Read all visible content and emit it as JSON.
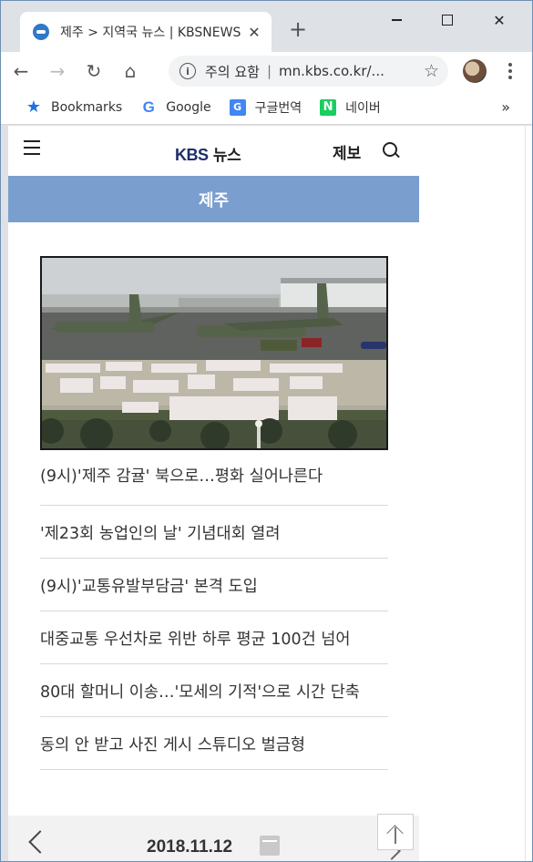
{
  "browser": {
    "tab_title": "제주 > 지역국 뉴스 | KBSNEWS",
    "tab_close": "✕",
    "new_tab": "+",
    "window_controls": {
      "minimize": "",
      "maximize": "",
      "close": "✕"
    },
    "nav": {
      "back": "←",
      "forward": "→",
      "reload": "↻",
      "home": "⌂"
    },
    "omnibox": {
      "security_label": "주의 요함",
      "separator": "|",
      "url": "mn.kbs.co.kr/...",
      "info_icon": "i",
      "star": "☆"
    },
    "bookmarks": [
      {
        "label": "Bookmarks",
        "icon": "★",
        "icon_name": "bookmarks-star-icon"
      },
      {
        "label": "Google",
        "icon": "G",
        "icon_name": "google-icon"
      },
      {
        "label": "구글번역",
        "icon": "G",
        "icon_name": "google-translate-icon"
      },
      {
        "label": "네이버",
        "icon": "N",
        "icon_name": "naver-icon"
      }
    ],
    "bookmarks_more": "»"
  },
  "site": {
    "logo_kbs": "KBS",
    "logo_news": " 뉴스",
    "report_label": "제보",
    "region": "제주",
    "headlines": [
      "(9시)'제주 감귤' 북으로…평화 실어나른다",
      "'제23회 농업인의 날' 기념대회 열려",
      "(9시)'교통유발부담금' 본격 도입",
      "대중교통 우선차로 위반 하루 평균 100건 넘어",
      "80대 할머니 이송…'모세의 기적'으로 시간 단축",
      "동의 안 받고 사진 게시 스튜디오 벌금형"
    ],
    "date": "2018.11.12"
  },
  "colors": {
    "region_bar": "#7a9fcf",
    "logo": "#1d2e6b",
    "desktop": "#3a6ea5"
  }
}
